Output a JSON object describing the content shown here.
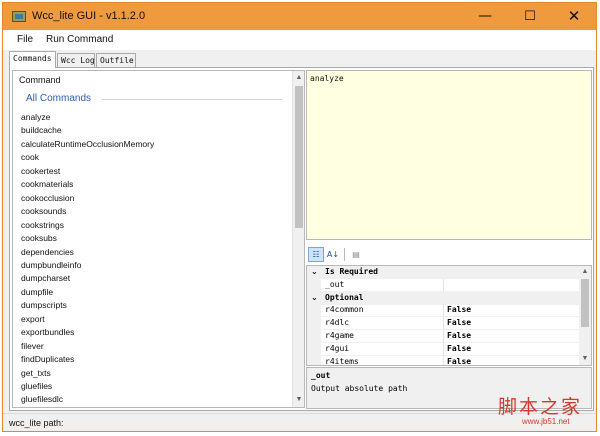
{
  "window": {
    "title": "Wcc_lite GUI - v1.1.2.0"
  },
  "menu": {
    "file": "File",
    "run_command": "Run Command"
  },
  "tabs": [
    {
      "label": "Commands",
      "active": true
    },
    {
      "label": "Wcc Log",
      "active": false
    },
    {
      "label": "Outfile",
      "active": false
    }
  ],
  "command_list": {
    "header": "Command",
    "group": "All Commands",
    "items": [
      "analyze",
      "buildcache",
      "calculateRuntimeOcclusionMemory",
      "cook",
      "cookertest",
      "cookmaterials",
      "cookocclusion",
      "cooksounds",
      "cookstrings",
      "cooksubs",
      "dependencies",
      "dumpbundleinfo",
      "dumpcharset",
      "dumpfile",
      "dumpscripts",
      "export",
      "exportbundles",
      "filever",
      "findDuplicates",
      "get_txts",
      "gluefiles",
      "gluefilesdlc"
    ]
  },
  "editor": {
    "text": "analyze"
  },
  "toolbar": {
    "categorized_glyph": "☷",
    "alphabetical_glyph": "A↓",
    "pages_glyph": "▤"
  },
  "property_grid": {
    "rows": [
      {
        "type": "category",
        "label": "Is Required"
      },
      {
        "type": "property",
        "name": "_out",
        "value": ""
      },
      {
        "type": "category",
        "label": "Optional"
      },
      {
        "type": "property",
        "name": "r4common",
        "value": "False"
      },
      {
        "type": "property",
        "name": "r4dlc",
        "value": "False"
      },
      {
        "type": "property",
        "name": "r4game",
        "value": "False"
      },
      {
        "type": "property",
        "name": "r4gui",
        "value": "False"
      },
      {
        "type": "property",
        "name": "r4items",
        "value": "False"
      }
    ]
  },
  "help": {
    "title": "_out",
    "description": "Output absolute path"
  },
  "status": {
    "text": "wcc_lite path:"
  },
  "watermark": {
    "text": "脚本之家",
    "sub": "www.jb51.net"
  },
  "colors": {
    "titlebar": "#ef9a3c",
    "editor_bg": "#ffffe1",
    "group_text": "#2a5ea8",
    "watermark": "#d33a2c"
  }
}
